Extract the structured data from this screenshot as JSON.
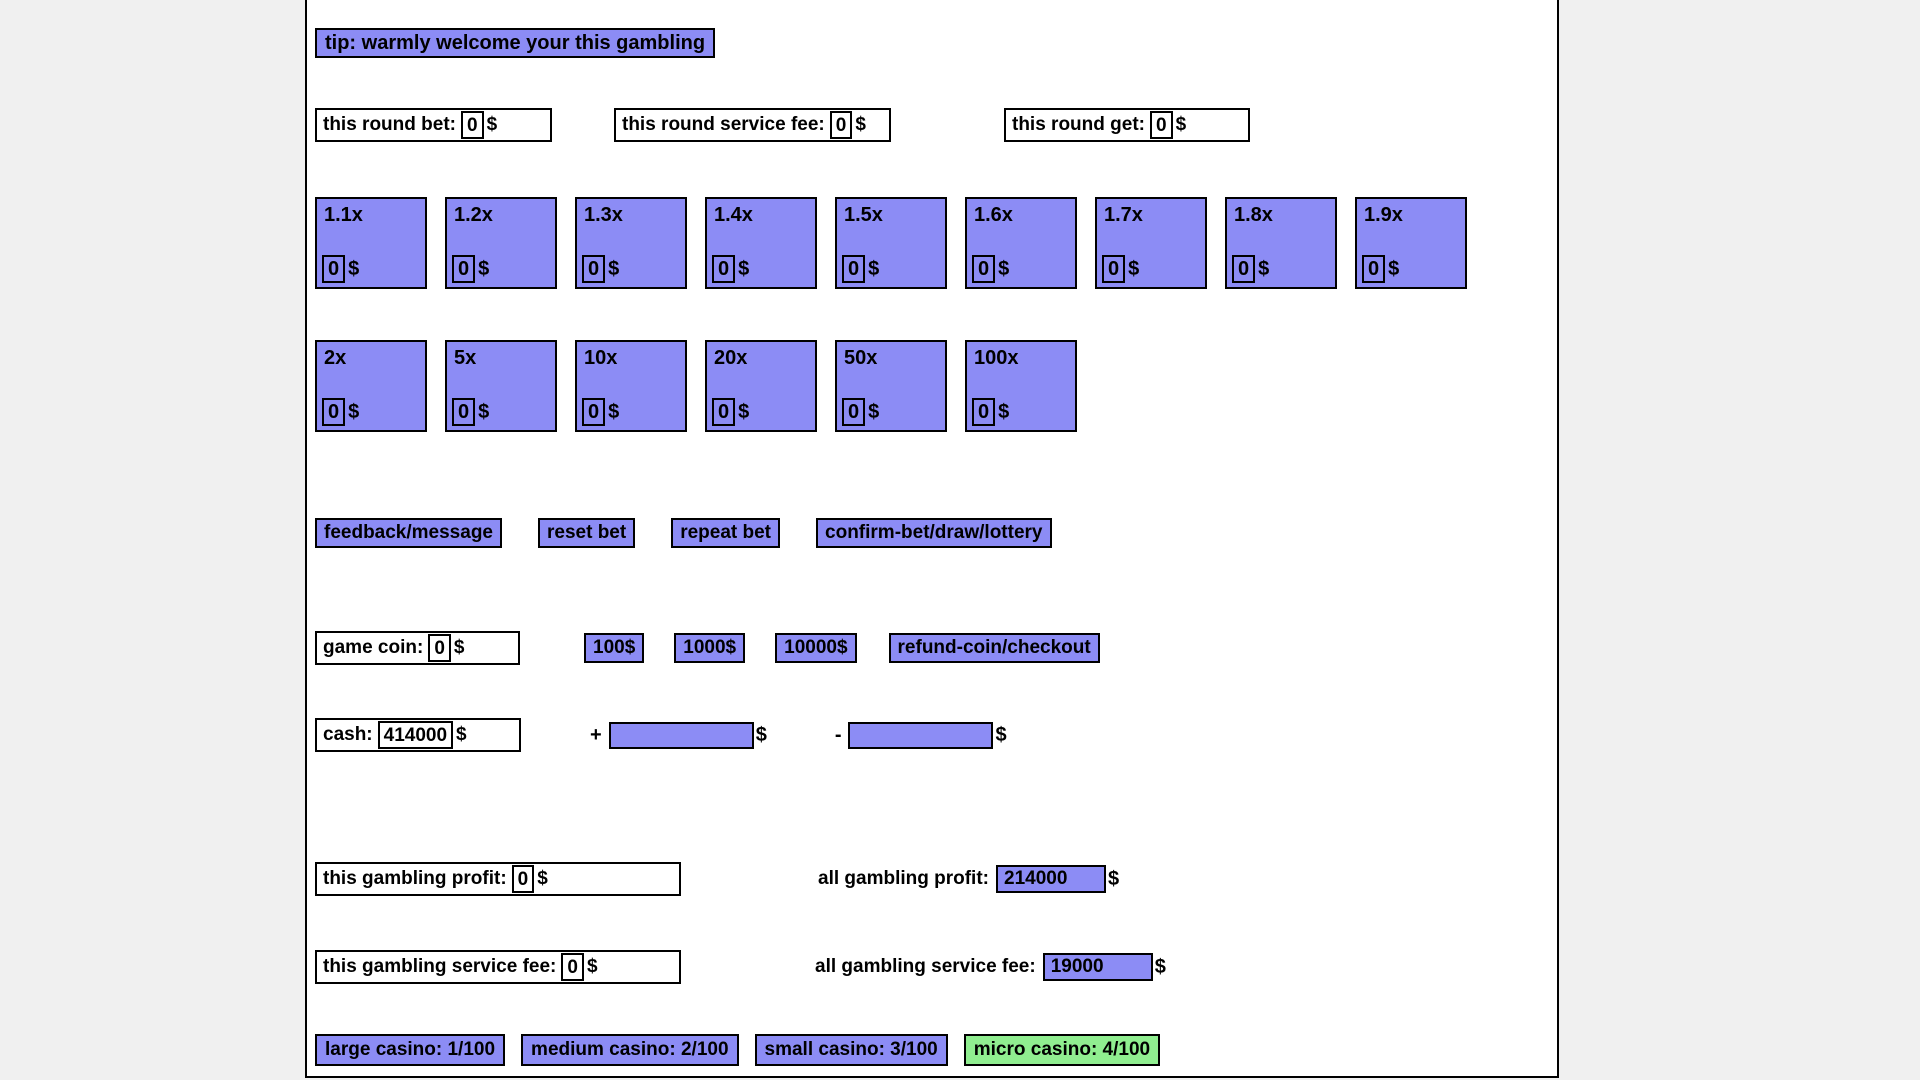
{
  "tip": {
    "text": "tip: warmly welcome your this gambling"
  },
  "round_stats": [
    {
      "label": "this round bet:",
      "value": "0",
      "unit": "$",
      "name": "this-round-bet"
    },
    {
      "label": "this round service fee:",
      "value": "0",
      "unit": "$",
      "name": "this-round-service-fee"
    },
    {
      "label": "this round get:",
      "value": "0",
      "unit": "$",
      "name": "this-round-get"
    }
  ],
  "multipliers_row1": [
    {
      "label": "1.1x",
      "bet": "0",
      "unit": "$"
    },
    {
      "label": "1.2x",
      "bet": "0",
      "unit": "$"
    },
    {
      "label": "1.3x",
      "bet": "0",
      "unit": "$"
    },
    {
      "label": "1.4x",
      "bet": "0",
      "unit": "$"
    },
    {
      "label": "1.5x",
      "bet": "0",
      "unit": "$"
    },
    {
      "label": "1.6x",
      "bet": "0",
      "unit": "$"
    },
    {
      "label": "1.7x",
      "bet": "0",
      "unit": "$"
    },
    {
      "label": "1.8x",
      "bet": "0",
      "unit": "$"
    },
    {
      "label": "1.9x",
      "bet": "0",
      "unit": "$"
    }
  ],
  "multipliers_row2": [
    {
      "label": "2x",
      "bet": "0",
      "unit": "$"
    },
    {
      "label": "5x",
      "bet": "0",
      "unit": "$"
    },
    {
      "label": "10x",
      "bet": "0",
      "unit": "$"
    },
    {
      "label": "20x",
      "bet": "0",
      "unit": "$"
    },
    {
      "label": "50x",
      "bet": "0",
      "unit": "$"
    },
    {
      "label": "100x",
      "bet": "0",
      "unit": "$"
    }
  ],
  "actions": [
    {
      "label": "feedback/message",
      "name": "feedback-message-button"
    },
    {
      "label": "reset bet",
      "name": "reset-bet-button"
    },
    {
      "label": "repeat bet",
      "name": "repeat-bet-button"
    },
    {
      "label": "confirm-bet/draw/lottery",
      "name": "confirm-bet-button"
    }
  ],
  "coin": {
    "label": "game coin:",
    "value": "0",
    "unit": "$",
    "buy_buttons": [
      {
        "label": "100$"
      },
      {
        "label": "1000$"
      },
      {
        "label": "10000$"
      }
    ],
    "refund_label": "refund-coin/checkout"
  },
  "cash": {
    "label": "cash:",
    "value": "414000",
    "unit": "$",
    "add": {
      "sign": "+",
      "value": "",
      "unit": "$"
    },
    "sub": {
      "sign": "-",
      "value": "",
      "unit": "$"
    }
  },
  "profit": {
    "this_label": "this gambling profit:",
    "this_value": "0",
    "this_unit": "$",
    "all_label": "all gambling profit:",
    "all_value": "214000",
    "all_unit": "$"
  },
  "service_fee": {
    "this_label": "this gambling service fee:",
    "this_value": "0",
    "this_unit": "$",
    "all_label": "all gambling service fee:",
    "all_value": "19000",
    "all_unit": "$"
  },
  "casinos": [
    {
      "label": "large casino: 1/100",
      "active": false
    },
    {
      "label": "medium casino: 2/100",
      "active": false
    },
    {
      "label": "small casino: 3/100",
      "active": false
    },
    {
      "label": "micro casino: 4/100",
      "active": true
    }
  ],
  "colors": {
    "accent_purple": "#8c8cf5",
    "active_green": "#90ee90",
    "border": "#000000",
    "page_bg": "#f0f0f0",
    "panel_bg": "#ffffff"
  }
}
